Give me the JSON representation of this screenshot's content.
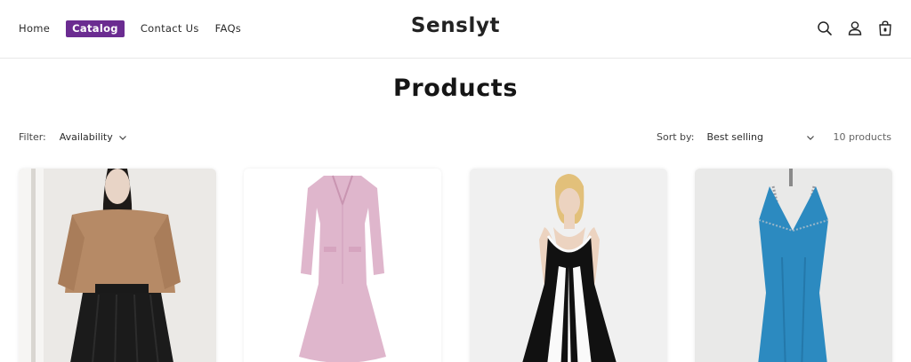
{
  "nav": {
    "items": [
      {
        "label": "Home"
      },
      {
        "label": "Catalog"
      },
      {
        "label": "Contact Us"
      },
      {
        "label": "FAQs"
      }
    ],
    "active_index": 1,
    "active_color": "#6b2c91"
  },
  "brand": {
    "name": "Senslyt"
  },
  "header_icons": [
    "search-icon",
    "account-icon",
    "cart-icon"
  ],
  "page": {
    "title": "Products"
  },
  "facets": {
    "filter_label": "Filter:",
    "availability_label": "Availability",
    "sort_label": "Sort by:",
    "sort_value": "Best selling",
    "product_count": "10 products"
  },
  "products": [
    {
      "image": "model in camel cropped jacket and black pleated skirt"
    },
    {
      "image": "pink knit midi dress"
    },
    {
      "image": "model in black and white halter dress"
    },
    {
      "image": "blue slip dress with embellished straps"
    }
  ]
}
